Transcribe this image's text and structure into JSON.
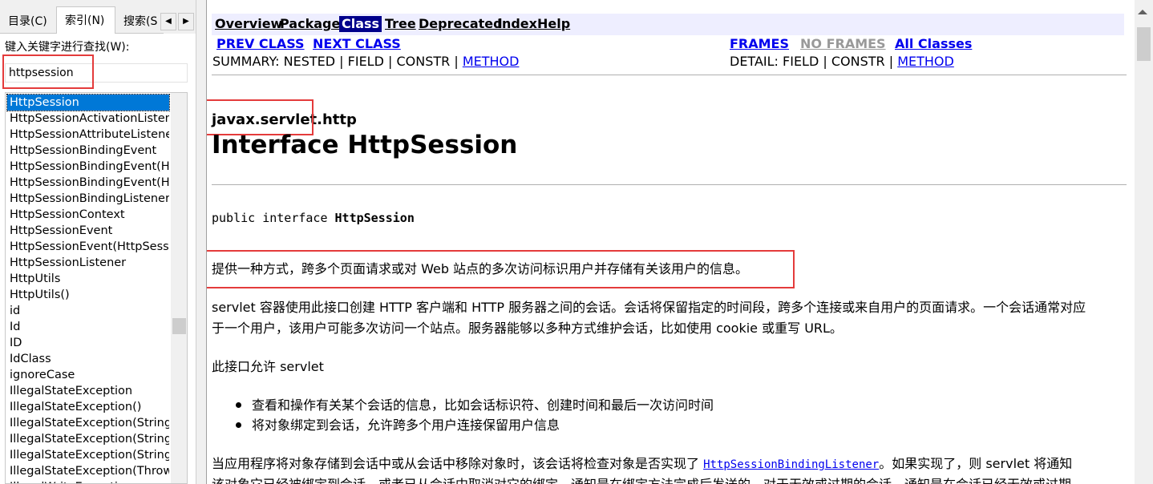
{
  "tabs": {
    "toc": "目录(C)",
    "index": "索引(N)",
    "search": "搜索(S",
    "prev_arrow": "◀",
    "next_arrow": "▶"
  },
  "index_pane": {
    "keyword_label": "键入关键字进行查找(W):",
    "keyword_value": "httpsession",
    "items": [
      "HttpSession",
      "HttpSessionActivationListener",
      "HttpSessionAttributeListener",
      "HttpSessionBindingEvent",
      "HttpSessionBindingEvent(HttpSession",
      "HttpSessionBindingEvent(HttpSession",
      "HttpSessionBindingListener",
      "HttpSessionContext",
      "HttpSessionEvent",
      "HttpSessionEvent(HttpSession",
      "HttpSessionListener",
      "HttpUtils",
      "HttpUtils()",
      "id",
      "Id",
      "ID",
      "IdClass",
      "ignoreCase",
      "IllegalStateException",
      "IllegalStateException()",
      "IllegalStateException(String",
      "IllegalStateException(String",
      "IllegalStateException(String",
      "IllegalStateException(Throwable",
      "IllegalWriteException"
    ],
    "selected_index": 0
  },
  "nav": {
    "overview": "Overview",
    "package": "Package",
    "class": "Class",
    "tree": "Tree",
    "deprecated": "Deprecated",
    "index": "Index",
    "help": "Help"
  },
  "subnav": {
    "prev_class": "PREV CLASS",
    "next_class": "NEXT CLASS",
    "frames": "FRAMES",
    "no_frames": "NO FRAMES",
    "all_classes": "All Classes",
    "summary_prefix": "SUMMARY: NESTED | FIELD | CONSTR | ",
    "summary_method": "METHOD",
    "detail_prefix": "DETAIL: FIELD | CONSTR | ",
    "detail_method": "METHOD"
  },
  "doc": {
    "package": "javax.servlet.http",
    "title": "Interface HttpSession",
    "signature_prefix": "public interface ",
    "signature_name": "HttpSession",
    "description": "提供一种方式，跨多个页面请求或对 Web 站点的多次访问标识用户并存储有关该用户的信息。",
    "para1_line1": "servlet 容器使用此接口创建 HTTP 客户端和 HTTP 服务器之间的会话。会话将保留指定的时间段，跨多个连接或来自用户的页面请求。一个会话通常对应",
    "para1_line2": "于一个用户，该用户可能多次访问一个站点。服务器能够以多种方式维护会话，比如使用 cookie 或重写 URL。",
    "para2": "此接口允许 servlet",
    "bullets": [
      "查看和操作有关某个会话的信息，比如会话标识符、创建时间和最后一次访问时间",
      "将对象绑定到会话，允许跨多个用户连接保留用户信息"
    ],
    "para3_prefix": "当应用程序将对象存储到会话中或从会话中移除对象时，该会话将检查对象是否实现了 ",
    "para3_link": "HttpSessionBindingListener",
    "para3_suffix": "。如果实现了，则 servlet 将通知",
    "para3_line2": "该对象它已经被绑定到会话，或者已从会话中取消对它的绑定。通知是在绑定方法完成后发送的。对于无效或过期的会话，通知是在会话已经无效或过期"
  }
}
